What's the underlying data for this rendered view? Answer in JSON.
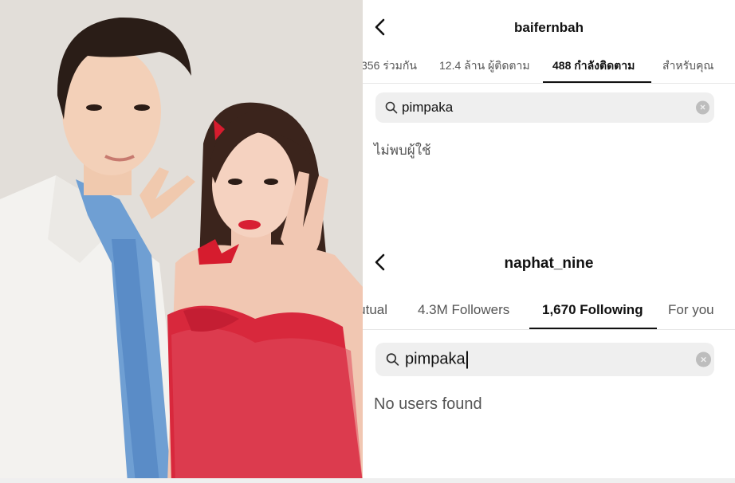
{
  "photo": {
    "description_icon": "photo-image",
    "colors": {
      "background": "#e0dcd8",
      "dress": "#d8283c",
      "jacket": "#f4f3f0",
      "shirt": "#6f9fd3"
    }
  },
  "top_panel": {
    "username": "baifernbah",
    "back_icon": "chevron-left-icon",
    "tabs": [
      "356 ร่วมกัน",
      "12.4 ล้าน ผู้ติดตาม",
      "488 กำลังติดตาม",
      "สำหรับคุณ"
    ],
    "active_tab": "488 กำลังติดตาม",
    "search_value": "pimpaka",
    "clear_icon": "clear-icon",
    "empty_text": "ไม่พบผู้ใช้"
  },
  "bottom_panel": {
    "username": "naphat_nine",
    "back_icon": "chevron-left-icon",
    "tabs": [
      "Mutual",
      "4.3M Followers",
      "1,670 Following",
      "For you"
    ],
    "active_tab": "1,670 Following",
    "search_value": "pimpaka",
    "clear_icon": "clear-icon",
    "empty_text": "No users found"
  }
}
